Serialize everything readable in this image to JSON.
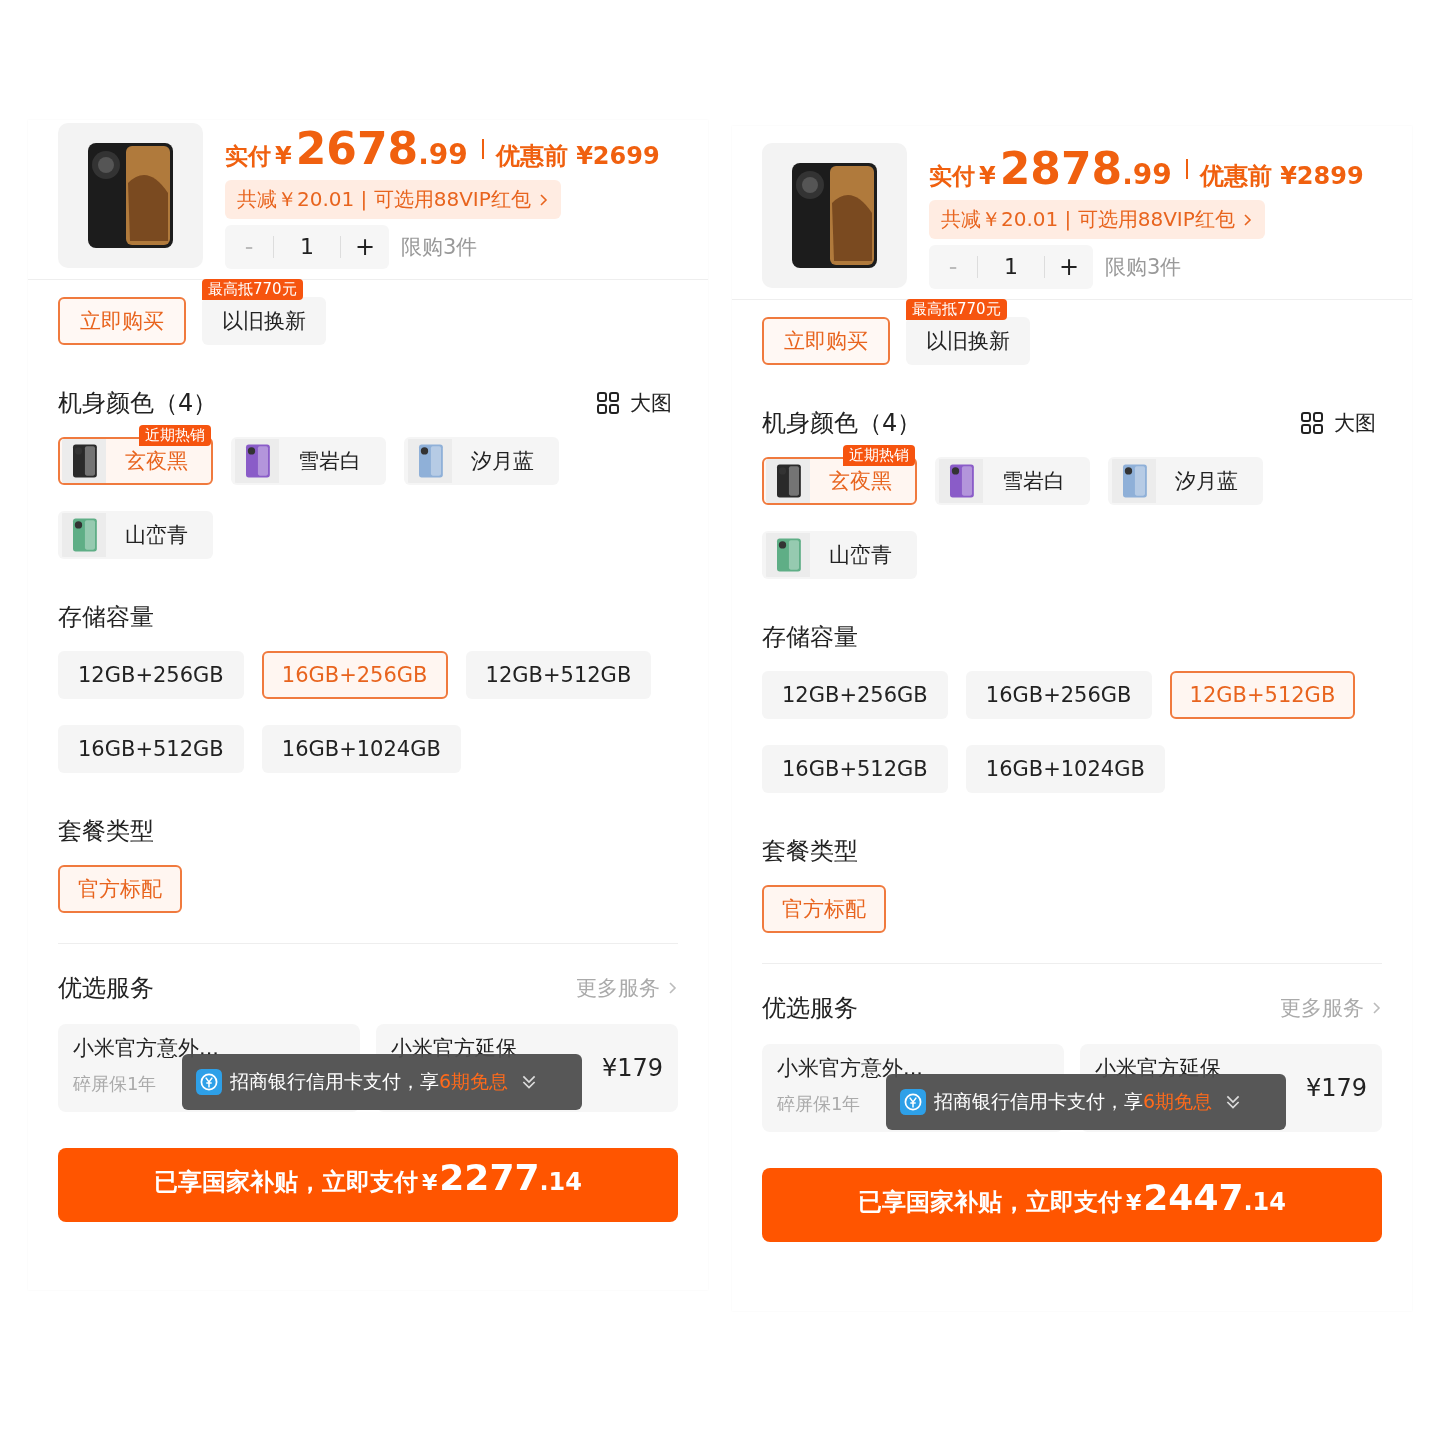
{
  "panels": [
    {
      "price": {
        "pay_label": "实付",
        "currency": "¥",
        "integer": "2678",
        "decimal": ".99",
        "before": "优惠前 ¥2699"
      },
      "discount": "共减￥20.01 | 可选用88VIP红包",
      "quantity": {
        "minus": "-",
        "value": "1",
        "plus": "+",
        "limit": "限购3件"
      },
      "actions": [
        {
          "label": "立即购买",
          "kind": "outline"
        },
        {
          "label": "以旧换新",
          "kind": "plain",
          "badge": "最高抵770元"
        }
      ],
      "colors": {
        "title": "机身颜色（4）",
        "view_label": "大图",
        "options": [
          {
            "label": "玄夜黑",
            "selected": true,
            "badge": "近期热销",
            "color": "#2a2a2a"
          },
          {
            "label": "雪岩白",
            "selected": false,
            "color": "#8a5cc8"
          },
          {
            "label": "汐月蓝",
            "selected": false,
            "color": "#8fb0d8"
          },
          {
            "label": "山峦青",
            "selected": false,
            "color": "#5fae86"
          }
        ]
      },
      "storage": {
        "title": "存储容量",
        "options": [
          {
            "label": "12GB+256GB",
            "selected": false
          },
          {
            "label": "16GB+256GB",
            "selected": true
          },
          {
            "label": "12GB+512GB",
            "selected": false
          },
          {
            "label": "16GB+512GB",
            "selected": false
          },
          {
            "label": "16GB+1024GB",
            "selected": false
          }
        ]
      },
      "package": {
        "title": "套餐类型",
        "options": [
          {
            "label": "官方标配",
            "selected": true
          }
        ]
      },
      "services": {
        "title": "优选服务",
        "more": "更多服务",
        "cards": [
          {
            "name": "小米官方意外...",
            "sub": "碎屏保1年"
          },
          {
            "name": "小米官方延保",
            "price": "¥179"
          }
        ]
      },
      "toast": {
        "text": "招商银行信用卡支付，享",
        "highlight": "6期免息"
      },
      "pay": {
        "label": "已享国家补贴，立即支付",
        "currency": "¥",
        "integer": "2277",
        "decimal": ".14"
      }
    },
    {
      "price": {
        "pay_label": "实付",
        "currency": "¥",
        "integer": "2878",
        "decimal": ".99",
        "before": "优惠前 ¥2899"
      },
      "discount": "共减￥20.01 | 可选用88VIP红包",
      "quantity": {
        "minus": "-",
        "value": "1",
        "plus": "+",
        "limit": "限购3件"
      },
      "actions": [
        {
          "label": "立即购买",
          "kind": "outline"
        },
        {
          "label": "以旧换新",
          "kind": "plain",
          "badge": "最高抵770元"
        }
      ],
      "colors": {
        "title": "机身颜色（4）",
        "view_label": "大图",
        "options": [
          {
            "label": "玄夜黑",
            "selected": true,
            "badge": "近期热销",
            "color": "#2a2a2a"
          },
          {
            "label": "雪岩白",
            "selected": false,
            "color": "#8a5cc8"
          },
          {
            "label": "汐月蓝",
            "selected": false,
            "color": "#8fb0d8"
          },
          {
            "label": "山峦青",
            "selected": false,
            "color": "#5fae86"
          }
        ]
      },
      "storage": {
        "title": "存储容量",
        "options": [
          {
            "label": "12GB+256GB",
            "selected": false
          },
          {
            "label": "16GB+256GB",
            "selected": false
          },
          {
            "label": "12GB+512GB",
            "selected": true
          },
          {
            "label": "16GB+512GB",
            "selected": false
          },
          {
            "label": "16GB+1024GB",
            "selected": false
          }
        ]
      },
      "package": {
        "title": "套餐类型",
        "options": [
          {
            "label": "官方标配",
            "selected": true
          }
        ]
      },
      "services": {
        "title": "优选服务",
        "more": "更多服务",
        "cards": [
          {
            "name": "小米官方意外...",
            "sub": "碎屏保1年"
          },
          {
            "name": "小米官方延保",
            "price": "¥179"
          }
        ]
      },
      "toast": {
        "text": "招商银行信用卡支付，享",
        "highlight": "6期免息"
      },
      "pay": {
        "label": "已享国家补贴，立即支付",
        "currency": "¥",
        "integer": "2447",
        "decimal": ".14"
      }
    }
  ]
}
